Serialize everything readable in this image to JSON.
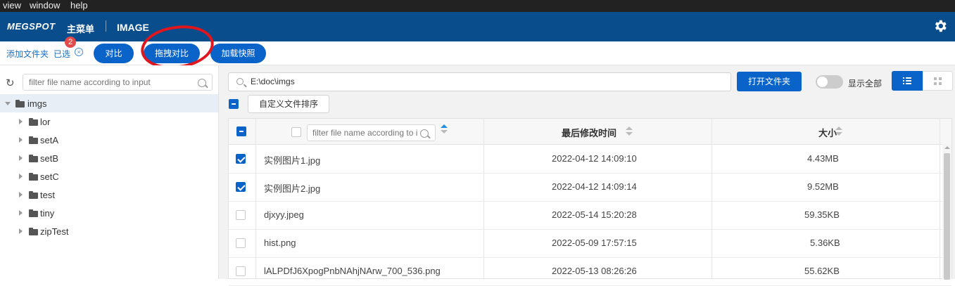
{
  "menubar": {
    "items": [
      "view",
      "window",
      "help"
    ]
  },
  "appbar": {
    "logo": "MEGSPOT",
    "main_menu": "主菜单",
    "title": "IMAGE"
  },
  "toolbar": {
    "add_folder": "添加文件夹",
    "selected": "已选",
    "selected_count": "2",
    "compare": "对比",
    "drag_compare": "拖拽对比",
    "load_snapshot": "加载快照"
  },
  "left": {
    "filter_placeholder": "filter file name according to input",
    "root": "imgs",
    "folders": [
      "lor",
      "setA",
      "setB",
      "setC",
      "test",
      "tiny",
      "zipTest"
    ]
  },
  "right": {
    "path_value": "E:\\doc\\imgs",
    "open_folder": "打开文件夹",
    "show_all": "显示全部",
    "custom_sort": "自定义文件排序",
    "table": {
      "filter_placeholder": "filter file name according to input",
      "col_modified": "最后修改时间",
      "col_size": "大小",
      "rows": [
        {
          "checked": true,
          "name": "实例图片1.jpg",
          "modified": "2022-04-12 14:09:10",
          "size": "4.43MB"
        },
        {
          "checked": true,
          "name": "实例图片2.jpg",
          "modified": "2022-04-12 14:09:14",
          "size": "9.52MB"
        },
        {
          "checked": false,
          "name": "djxyy.jpeg",
          "modified": "2022-05-14 15:20:28",
          "size": "59.35KB"
        },
        {
          "checked": false,
          "name": "hist.png",
          "modified": "2022-05-09 17:57:15",
          "size": "5.36KB"
        },
        {
          "checked": false,
          "name": "lALPDfJ6XpogPnbNAhjNArw_700_536.png",
          "modified": "2022-05-13 08:26:26",
          "size": "55.62KB"
        }
      ]
    }
  },
  "colors": {
    "brand": "#0a4d8c",
    "accent": "#0a63c9",
    "badge": "#e34b4b",
    "annotation": "#e0161e"
  },
  "icons": [
    "gear-icon",
    "refresh-icon",
    "search-icon",
    "folder-icon",
    "list-view-icon",
    "grid-view-icon",
    "sort-icon",
    "clear-icon"
  ]
}
